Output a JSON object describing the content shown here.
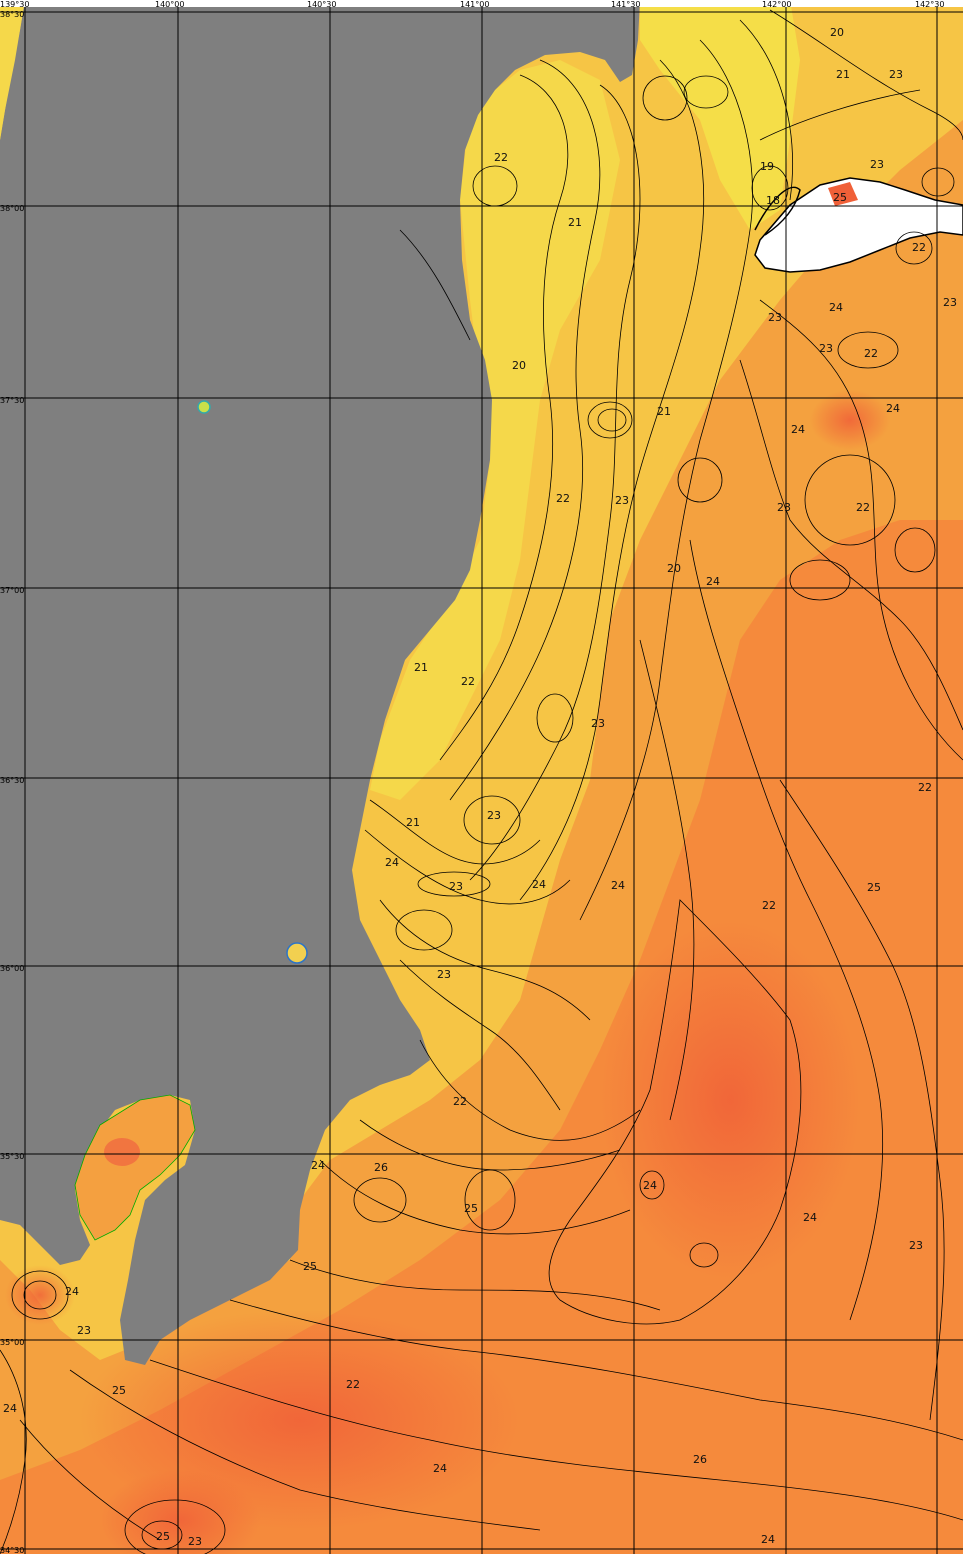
{
  "map": {
    "colors": {
      "land": "#7f7f7f",
      "warm": "#f07040",
      "mid": "#f7a040",
      "cool": "#f6c845",
      "coast": "#f5e34a",
      "cloud": "#ffffff",
      "grid": "#000000"
    },
    "lon_labels": [
      "139°30",
      "140°00",
      "140°30",
      "141°00",
      "141°30",
      "142°00",
      "142°30"
    ],
    "lat_labels": [
      "38°30",
      "38°00",
      "37°30",
      "37°00",
      "36°30",
      "36°00",
      "35°30",
      "35°00",
      "34°30"
    ],
    "contour_labels": [
      {
        "text": "20"
      },
      {
        "text": "21"
      },
      {
        "text": "23"
      },
      {
        "text": "19"
      },
      {
        "text": "23"
      },
      {
        "text": "18"
      },
      {
        "text": "25"
      },
      {
        "text": "22"
      },
      {
        "text": "21"
      },
      {
        "text": "22"
      },
      {
        "text": "23"
      },
      {
        "text": "24"
      },
      {
        "text": "23"
      },
      {
        "text": "23"
      },
      {
        "text": "22"
      },
      {
        "text": "20"
      },
      {
        "text": "21"
      },
      {
        "text": "24"
      },
      {
        "text": "24"
      },
      {
        "text": "22"
      },
      {
        "text": "23"
      },
      {
        "text": "23"
      },
      {
        "text": "22"
      },
      {
        "text": "24"
      },
      {
        "text": "20"
      },
      {
        "text": "21"
      },
      {
        "text": "22"
      },
      {
        "text": "23"
      },
      {
        "text": "22"
      },
      {
        "text": "21"
      },
      {
        "text": "23"
      },
      {
        "text": "24"
      },
      {
        "text": "23"
      },
      {
        "text": "24"
      },
      {
        "text": "24"
      },
      {
        "text": "25"
      },
      {
        "text": "22"
      },
      {
        "text": "23"
      },
      {
        "text": "22"
      },
      {
        "text": "24"
      },
      {
        "text": "26"
      },
      {
        "text": "24"
      },
      {
        "text": "25"
      },
      {
        "text": "24"
      },
      {
        "text": "23"
      },
      {
        "text": "25"
      },
      {
        "text": "24"
      },
      {
        "text": "23"
      },
      {
        "text": "25"
      },
      {
        "text": "22"
      },
      {
        "text": "24"
      },
      {
        "text": "24"
      },
      {
        "text": "26"
      },
      {
        "text": "25"
      },
      {
        "text": "23"
      },
      {
        "text": "24"
      }
    ]
  }
}
